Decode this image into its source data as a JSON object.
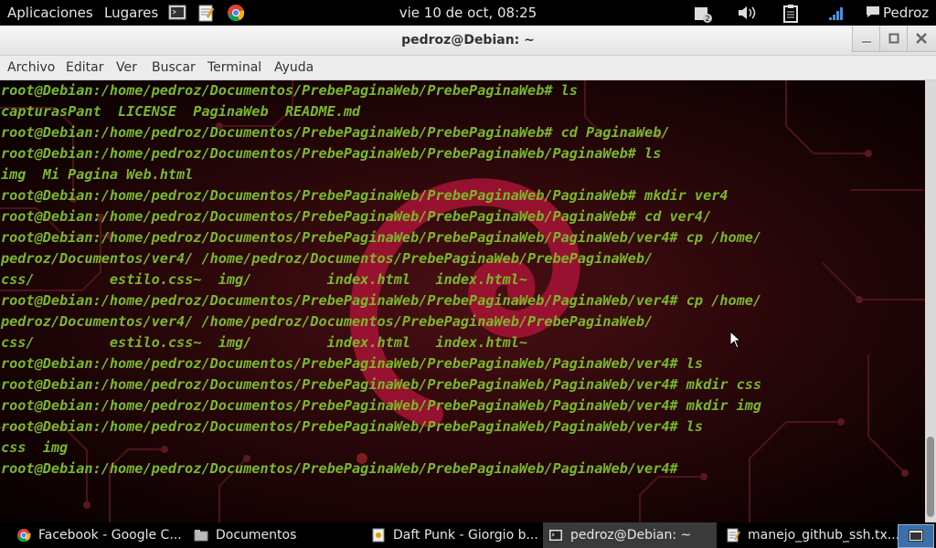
{
  "top_panel": {
    "applications": "Aplicaciones",
    "places": "Lugares",
    "clock": "vie 10 de oct, 08:25",
    "user": "Pedroz"
  },
  "window": {
    "title": "pedroz@Debian: ~"
  },
  "menubar": [
    "Archivo",
    "Editar",
    "Ver",
    "Buscar",
    "Terminal",
    "Ayuda"
  ],
  "terminal_lines": [
    "root@Debian:/home/pedroz/Documentos/PrebePaginaWeb/PrebePaginaWeb# ls",
    "capturasPant  LICENSE  PaginaWeb  README.md",
    "root@Debian:/home/pedroz/Documentos/PrebePaginaWeb/PrebePaginaWeb# cd PaginaWeb/",
    "root@Debian:/home/pedroz/Documentos/PrebePaginaWeb/PrebePaginaWeb/PaginaWeb# ls",
    "img  Mi Pagina Web.html",
    "root@Debian:/home/pedroz/Documentos/PrebePaginaWeb/PrebePaginaWeb/PaginaWeb# mkdir ver4",
    "root@Debian:/home/pedroz/Documentos/PrebePaginaWeb/PrebePaginaWeb/PaginaWeb# cd ver4/",
    "root@Debian:/home/pedroz/Documentos/PrebePaginaWeb/PrebePaginaWeb/PaginaWeb/ver4# cp /home/",
    "pedroz/Documentos/ver4/ /home/pedroz/Documentos/PrebePaginaWeb/PrebePaginaWeb/",
    "css/         estilo.css~  img/         index.html   index.html~",
    "root@Debian:/home/pedroz/Documentos/PrebePaginaWeb/PrebePaginaWeb/PaginaWeb/ver4# cp /home/",
    "pedroz/Documentos/ver4/ /home/pedroz/Documentos/PrebePaginaWeb/PrebePaginaWeb/",
    "css/         estilo.css~  img/         index.html   index.html~",
    "root@Debian:/home/pedroz/Documentos/PrebePaginaWeb/PrebePaginaWeb/PaginaWeb/ver4# ls",
    "root@Debian:/home/pedroz/Documentos/PrebePaginaWeb/PrebePaginaWeb/PaginaWeb/ver4# mkdir css",
    "root@Debian:/home/pedroz/Documentos/PrebePaginaWeb/PrebePaginaWeb/PaginaWeb/ver4# mkdir img",
    "root@Debian:/home/pedroz/Documentos/PrebePaginaWeb/PrebePaginaWeb/PaginaWeb/ver4# ls",
    "css  img",
    "root@Debian:/home/pedroz/Documentos/PrebePaginaWeb/PrebePaginaWeb/PaginaWeb/ver4#"
  ],
  "taskbar": [
    {
      "label": "Facebook - Google C...",
      "icon": "chrome-icon"
    },
    {
      "label": "Documentos",
      "icon": "folder-icon"
    },
    {
      "label": "Daft Punk - Giorgio b...",
      "icon": "media-icon"
    },
    {
      "label": "pedroz@Debian: ~",
      "icon": "terminal-icon",
      "active": true
    },
    {
      "label": "manejo_github_ssh.tx...",
      "icon": "text-editor-icon"
    }
  ],
  "colors": {
    "terminal_text": "#7ab82a",
    "debian_swirl": "#c4143c",
    "panel_bg": "#000000"
  }
}
